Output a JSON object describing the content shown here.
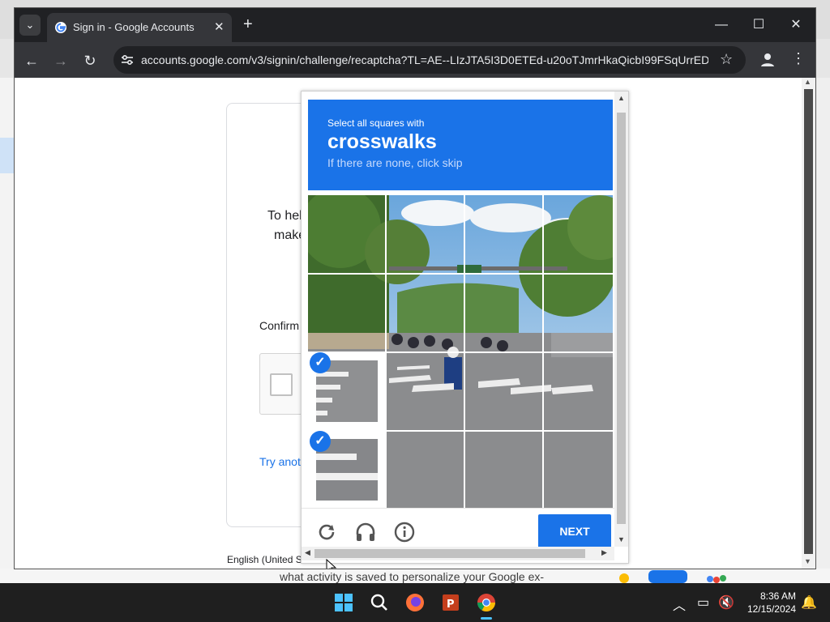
{
  "browser": {
    "tab_title": "Sign in - Google Accounts",
    "url": "accounts.google.com/v3/signin/challenge/recaptcha?TL=AE--LIzJTA5I3D0ETEd-u20oTJmrHkaQicbI99FSqUrrEDQ..."
  },
  "page": {
    "partial_text_1": "To hel",
    "partial_text_2": "make",
    "confirm_text": "Confirm",
    "try_another": "Try anot",
    "language": "English (United S",
    "background_text": "what activity is saved to personalize your Google ex-"
  },
  "captcha": {
    "prompt_line1": "Select all squares with",
    "prompt_target": "crosswalks",
    "prompt_line3": "If there are none, click skip",
    "selected_tiles": [
      9,
      13
    ],
    "next_label": "NEXT",
    "icons": [
      "reload-icon",
      "audio-challenge-icon",
      "info-icon"
    ]
  },
  "taskbar": {
    "time": "8:36 AM",
    "date": "12/15/2024"
  },
  "colors": {
    "captcha_blue": "#1a73e8",
    "browser_dark": "#202124"
  }
}
